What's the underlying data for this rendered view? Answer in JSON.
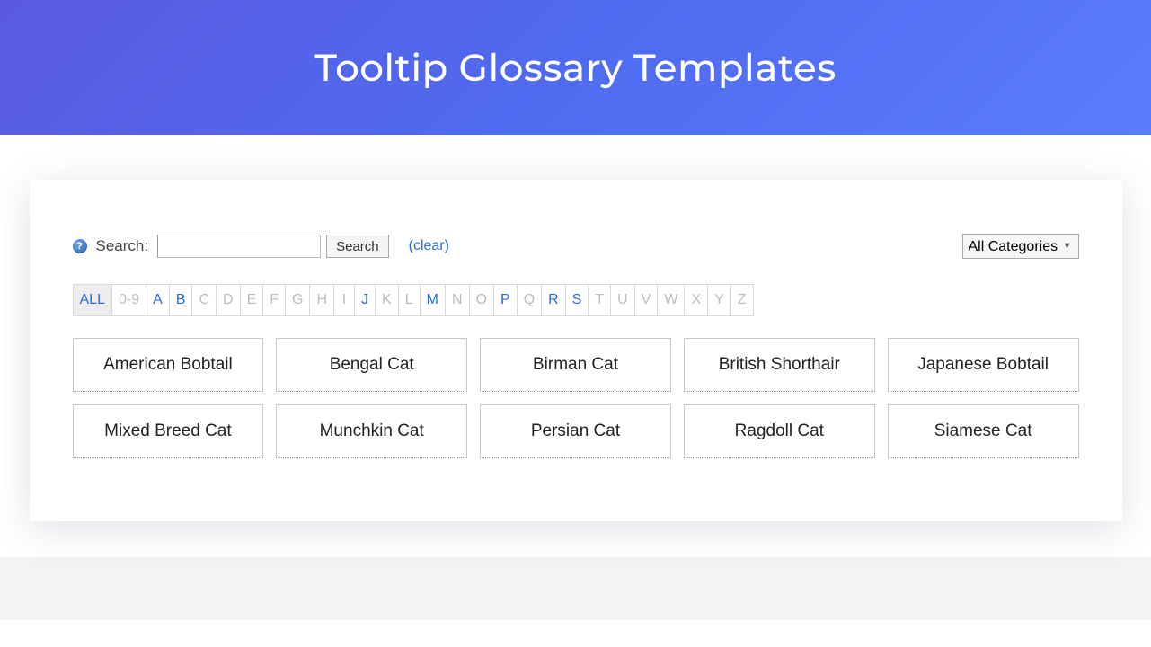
{
  "hero": {
    "title": "Tooltip Glossary Templates"
  },
  "search": {
    "label": "Search:",
    "button": "Search",
    "clear": "(clear)",
    "help_symbol": "?"
  },
  "category": {
    "selected": "All Categories"
  },
  "alpha": {
    "active_letters": [
      "ALL",
      "A",
      "B",
      "J",
      "M",
      "P",
      "R",
      "S"
    ],
    "selected": "ALL",
    "buttons": [
      "ALL",
      "0-9",
      "A",
      "B",
      "C",
      "D",
      "E",
      "F",
      "G",
      "H",
      "I",
      "J",
      "K",
      "L",
      "M",
      "N",
      "O",
      "P",
      "Q",
      "R",
      "S",
      "T",
      "U",
      "V",
      "W",
      "X",
      "Y",
      "Z"
    ]
  },
  "tiles": [
    "American Bobtail",
    "Bengal Cat",
    "Birman Cat",
    "British Shorthair",
    "Japanese Bobtail",
    "Mixed Breed Cat",
    "Munchkin Cat",
    "Persian Cat",
    "Ragdoll Cat",
    "Siamese Cat"
  ]
}
